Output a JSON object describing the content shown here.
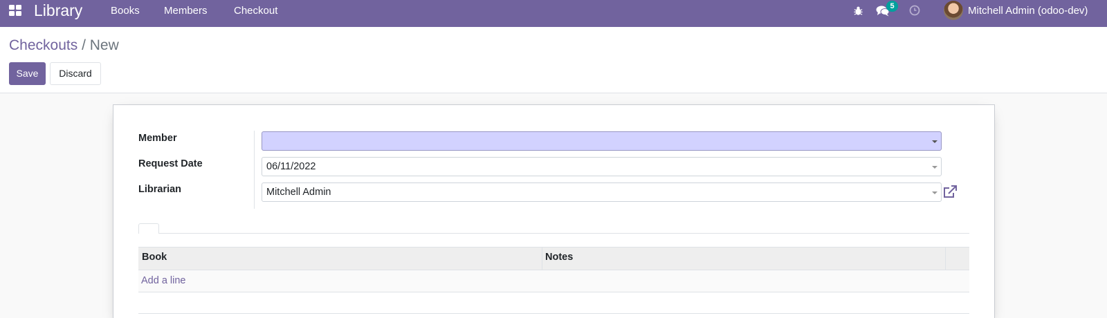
{
  "navbar": {
    "app_name": "Library",
    "menu": [
      "Books",
      "Members",
      "Checkout"
    ],
    "messages_count": "5",
    "user": "Mitchell Admin (odoo-dev)"
  },
  "breadcrumb": {
    "parent": "Checkouts",
    "separator": "/",
    "current": "New"
  },
  "actions": {
    "save_label": "Save",
    "discard_label": "Discard"
  },
  "form": {
    "member_label": "Member",
    "member_value": "",
    "request_date_label": "Request Date",
    "request_date_value": "06/11/2022",
    "librarian_label": "Librarian",
    "librarian_value": "Mitchell Admin"
  },
  "lines": {
    "columns": [
      "Book",
      "Notes"
    ],
    "add_line_label": "Add a line"
  },
  "colors": {
    "brand": "#71639e",
    "required_field": "#d2d2ff",
    "badge": "#00a09d"
  },
  "icons": [
    "apps-grid-icon",
    "bug-icon",
    "chat-icon",
    "clock-icon",
    "external-link-icon",
    "chevron-down-icon"
  ]
}
